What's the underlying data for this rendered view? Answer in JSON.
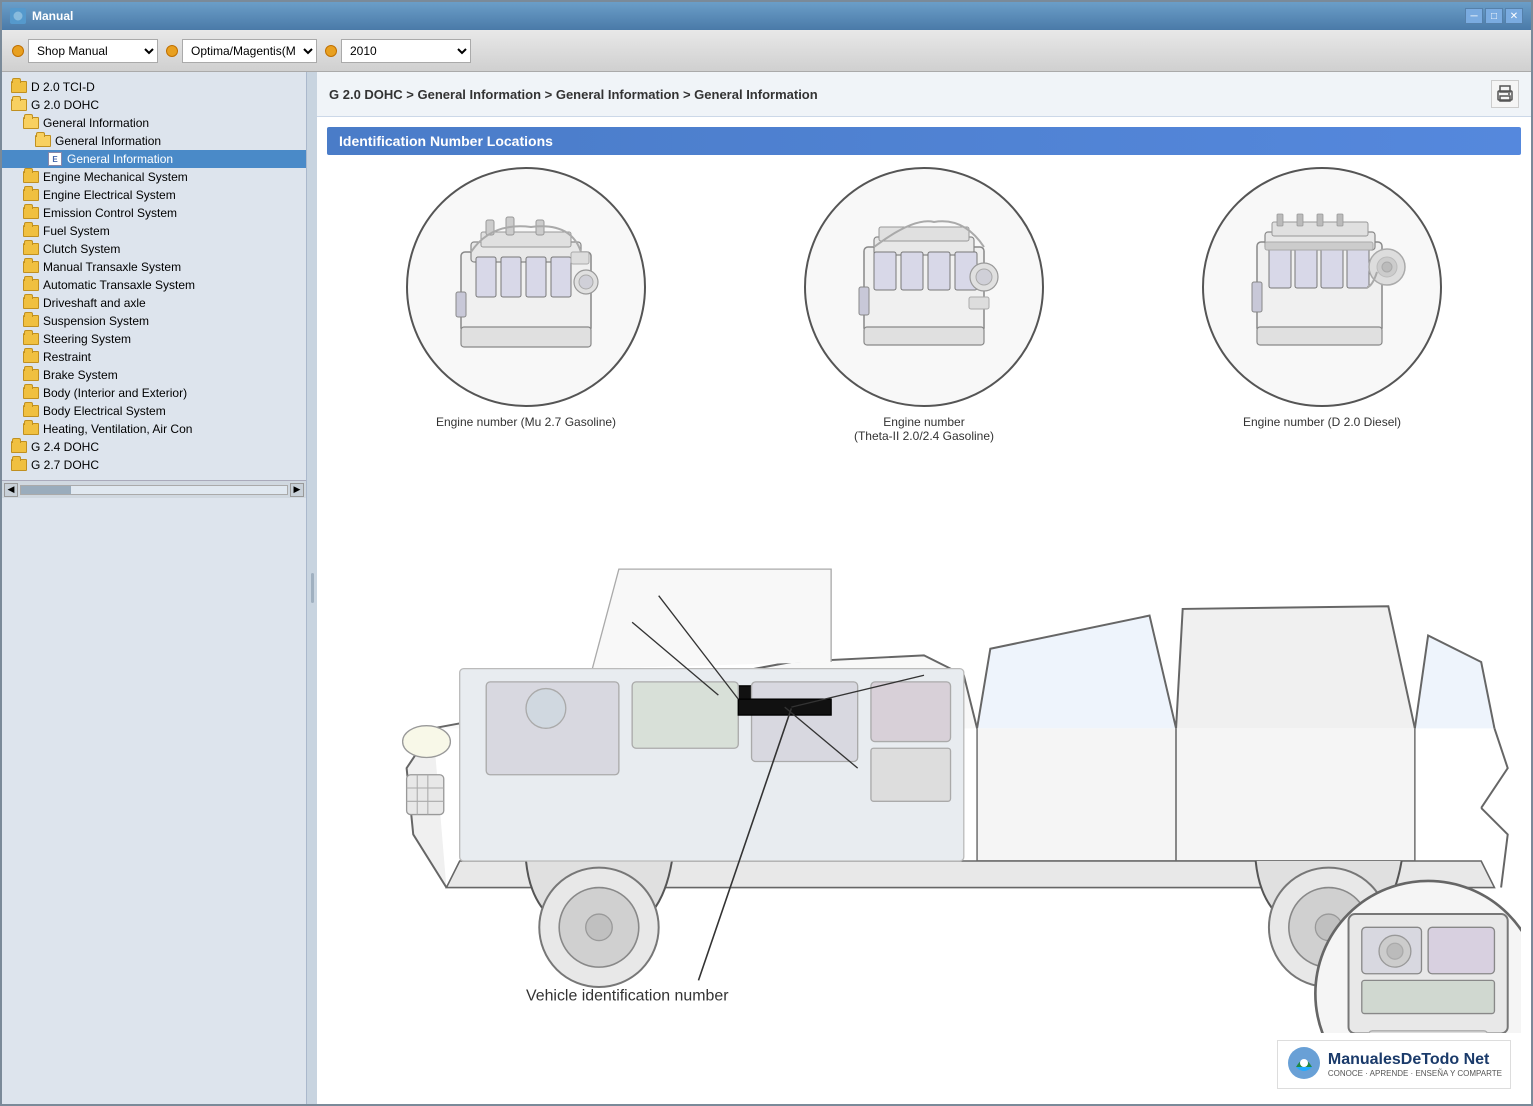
{
  "window": {
    "title": "Manual",
    "icon": "M"
  },
  "toolbar": {
    "manual_type_label": "Shop Manual",
    "model_label": "Optima/Magentis(M",
    "year_label": "2010",
    "dot_color": "#e8a020"
  },
  "title_controls": {
    "minimize": "─",
    "maximize": "□",
    "close": "✕"
  },
  "breadcrumb": "G 2.0 DOHC > General Information > General Information > General Information",
  "section_header": "Identification Number Locations",
  "sidebar": {
    "items": [
      {
        "id": "d20tcid",
        "label": "D 2.0 TCI-D",
        "indent": 0,
        "type": "folder",
        "selected": false
      },
      {
        "id": "g20dohc",
        "label": "G 2.0 DOHC",
        "indent": 0,
        "type": "folder-open",
        "selected": false
      },
      {
        "id": "general-info-1",
        "label": "General Information",
        "indent": 1,
        "type": "folder-open",
        "selected": false
      },
      {
        "id": "general-info-2",
        "label": "General Information",
        "indent": 2,
        "type": "folder-open",
        "selected": false
      },
      {
        "id": "general-info-3",
        "label": "General Information",
        "indent": 3,
        "type": "doc",
        "selected": true
      },
      {
        "id": "engine-mech",
        "label": "Engine Mechanical System",
        "indent": 1,
        "type": "folder",
        "selected": false
      },
      {
        "id": "engine-elec",
        "label": "Engine Electrical System",
        "indent": 1,
        "type": "folder",
        "selected": false
      },
      {
        "id": "emission",
        "label": "Emission Control System",
        "indent": 1,
        "type": "folder",
        "selected": false
      },
      {
        "id": "fuel",
        "label": "Fuel System",
        "indent": 1,
        "type": "folder",
        "selected": false
      },
      {
        "id": "clutch",
        "label": "Clutch System",
        "indent": 1,
        "type": "folder",
        "selected": false
      },
      {
        "id": "manual-trans",
        "label": "Manual Transaxle System",
        "indent": 1,
        "type": "folder",
        "selected": false
      },
      {
        "id": "auto-trans",
        "label": "Automatic Transaxle System",
        "indent": 1,
        "type": "folder",
        "selected": false
      },
      {
        "id": "driveshaft",
        "label": "Driveshaft and axle",
        "indent": 1,
        "type": "folder",
        "selected": false
      },
      {
        "id": "suspension",
        "label": "Suspension System",
        "indent": 1,
        "type": "folder",
        "selected": false
      },
      {
        "id": "steering",
        "label": "Steering System",
        "indent": 1,
        "type": "folder",
        "selected": false
      },
      {
        "id": "restraint",
        "label": "Restraint",
        "indent": 1,
        "type": "folder",
        "selected": false
      },
      {
        "id": "brake",
        "label": "Brake System",
        "indent": 1,
        "type": "folder",
        "selected": false
      },
      {
        "id": "body-int-ext",
        "label": "Body (Interior and Exterior)",
        "indent": 1,
        "type": "folder",
        "selected": false
      },
      {
        "id": "body-elec",
        "label": "Body Electrical System",
        "indent": 1,
        "type": "folder",
        "selected": false
      },
      {
        "id": "heating",
        "label": "Heating, Ventilation, Air Con",
        "indent": 1,
        "type": "folder",
        "selected": false
      },
      {
        "id": "g24dohc",
        "label": "G 2.4 DOHC",
        "indent": 0,
        "type": "folder",
        "selected": false
      },
      {
        "id": "g27dohc",
        "label": "G 2.7 DOHC",
        "indent": 0,
        "type": "folder",
        "selected": false
      }
    ]
  },
  "engines": [
    {
      "id": "mu27",
      "label": "Engine number (Mu 2.7 Gasoline)"
    },
    {
      "id": "theta2",
      "label": "Engine number\n(Theta-II 2.0/2.4 Gasoline)"
    },
    {
      "id": "d20diesel",
      "label": "Engine number (D 2.0 Diesel)"
    }
  ],
  "vehicle_label": "Vehicle identification number",
  "watermark": {
    "brand": "ManualesDeTodo Net",
    "sub": "CONOCE · APRENDE · ENSEÑA Y COMPARTE"
  }
}
